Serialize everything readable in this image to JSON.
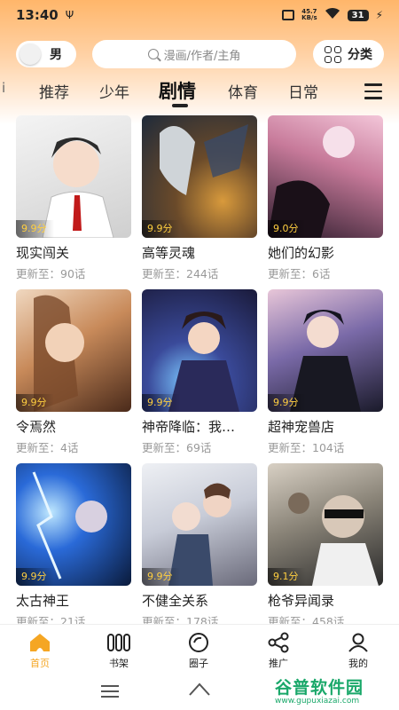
{
  "status_bar": {
    "time": "13:40",
    "net_speed_value": "45.7",
    "net_speed_unit": "KB/s",
    "battery": "31"
  },
  "header": {
    "gender_label": "男",
    "search_placeholder": "漫画/作者/主角",
    "category_label": "分类"
  },
  "tabs": [
    {
      "label": "推荐"
    },
    {
      "label": "少年"
    },
    {
      "label": "剧情"
    },
    {
      "label": "体育"
    },
    {
      "label": "日常"
    }
  ],
  "active_tab": "剧情",
  "comics": [
    {
      "title": "现实闯关",
      "score": "9.9分",
      "update": "更新至：90话"
    },
    {
      "title": "高等灵魂",
      "score": "9.9分",
      "update": "更新至：244话"
    },
    {
      "title": "她们的幻影",
      "score": "9.0分",
      "update": "更新至：6话"
    },
    {
      "title": "令焉然",
      "score": "9.9分",
      "update": "更新至：4话"
    },
    {
      "title": "神帝降临：我…",
      "score": "9.9分",
      "update": "更新至：69话"
    },
    {
      "title": "超神宠兽店",
      "score": "9.9分",
      "update": "更新至：104话"
    },
    {
      "title": "太古神王",
      "score": "9.9分",
      "update": "更新至：21话"
    },
    {
      "title": "不健全关系",
      "score": "9.9分",
      "update": "更新至：178话"
    },
    {
      "title": "枪爷异闻录",
      "score": "9.1分",
      "update": "更新至：458话"
    }
  ],
  "bottom_nav": [
    {
      "label": "首页",
      "icon": "home-icon"
    },
    {
      "label": "书架",
      "icon": "bookshelf-icon"
    },
    {
      "label": "圈子",
      "icon": "circle-icon"
    },
    {
      "label": "推广",
      "icon": "share-icon"
    },
    {
      "label": "我的",
      "icon": "profile-icon"
    }
  ],
  "watermark": {
    "main": "谷普软件园",
    "sub": "www.gupuxiazai.com"
  },
  "colors": {
    "accent": "#f5a623",
    "score": "#ffcf40",
    "header_gradient_top": "#ffb66a"
  }
}
